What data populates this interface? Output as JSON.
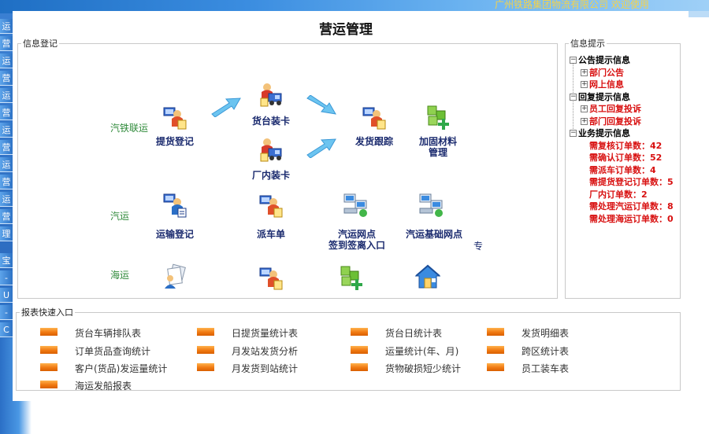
{
  "page_title": "营运管理",
  "banner": {
    "text": "广州铁路集团物流有限公司   欢迎使用"
  },
  "left_tabs": [
    "运",
    "营",
    "运",
    "营",
    "运",
    "营",
    "运",
    "营",
    "运",
    "营",
    "运",
    "营",
    "理",
    "宝",
    "-",
    "U",
    "-",
    "C"
  ],
  "main_flow": {
    "legend": "信息登记",
    "rows": {
      "rail": "汽铁联运",
      "road": "汽运",
      "sea": "海运"
    },
    "nodes": {
      "pickup_register": "提货登记",
      "platform_loading": "货台装卡",
      "factory_loading": "厂内装卡",
      "shipment_tracking": "发货跟踪",
      "reinforce_material_line1": "加固材料",
      "reinforce_material_line2": "管理",
      "transport_register": "运输登记",
      "dispatch_order": "派车单",
      "road_network_line1": "汽运网点",
      "road_network_line2": "签到签离入口",
      "road_base_network": "汽运基础网点",
      "truncated_char": "专"
    },
    "icons": {
      "pickup_register": "worker-document-icon",
      "platform_loading": "worker-truck-icon",
      "factory_loading": "worker-truck-icon",
      "shipment_tracking": "worker-document-icon",
      "reinforce_material": "green-cubes-plus-icon",
      "transport_register": "worker-blue-doc-icon",
      "dispatch_order": "worker-document-icon",
      "road_network": "network-computers-icon",
      "road_base_network": "network-computers-icon",
      "sea_register": "person-documents-icon",
      "sea_dispatch": "worker-document-icon",
      "sea_cubes": "green-cubes-plus-icon",
      "sea_house": "blue-house-icon"
    }
  },
  "info_tip": {
    "legend": "信息提示",
    "categories": [
      {
        "label": "公告提示信息",
        "items": [
          "部门公告",
          "网上信息"
        ]
      },
      {
        "label": "回复提示信息",
        "items": [
          "员工回复投诉",
          "部门回复投诉"
        ]
      },
      {
        "label": "业务提示信息",
        "leaves": [
          "需复核订单数：42",
          "需确认订单数：52",
          "需派车订单数：4",
          "需提货登记订单数：5",
          "厂内订单数：2",
          "需处理汽运订单数：8",
          "需处理海运订单数：0"
        ]
      }
    ]
  },
  "reports": {
    "legend": "报表快速入口",
    "items": [
      "货台车辆排队表",
      "日提货量统计表",
      "货台日统计表",
      "发货明细表",
      "订单货品查询统计",
      "月发站发货分析",
      "运量统计(年、月)",
      "跨区统计表",
      "客户(货品)发运量统计",
      "月发货到站统计",
      "货物破损短少统计",
      "员工装车表",
      "海运发船报表"
    ]
  },
  "colors": {
    "node_label": "#1a2a6e",
    "row_label": "#2f8a3a",
    "tree_red": "#d81010",
    "report_bar": "#f07a12",
    "chrome_blue": "#2c6cc0"
  }
}
